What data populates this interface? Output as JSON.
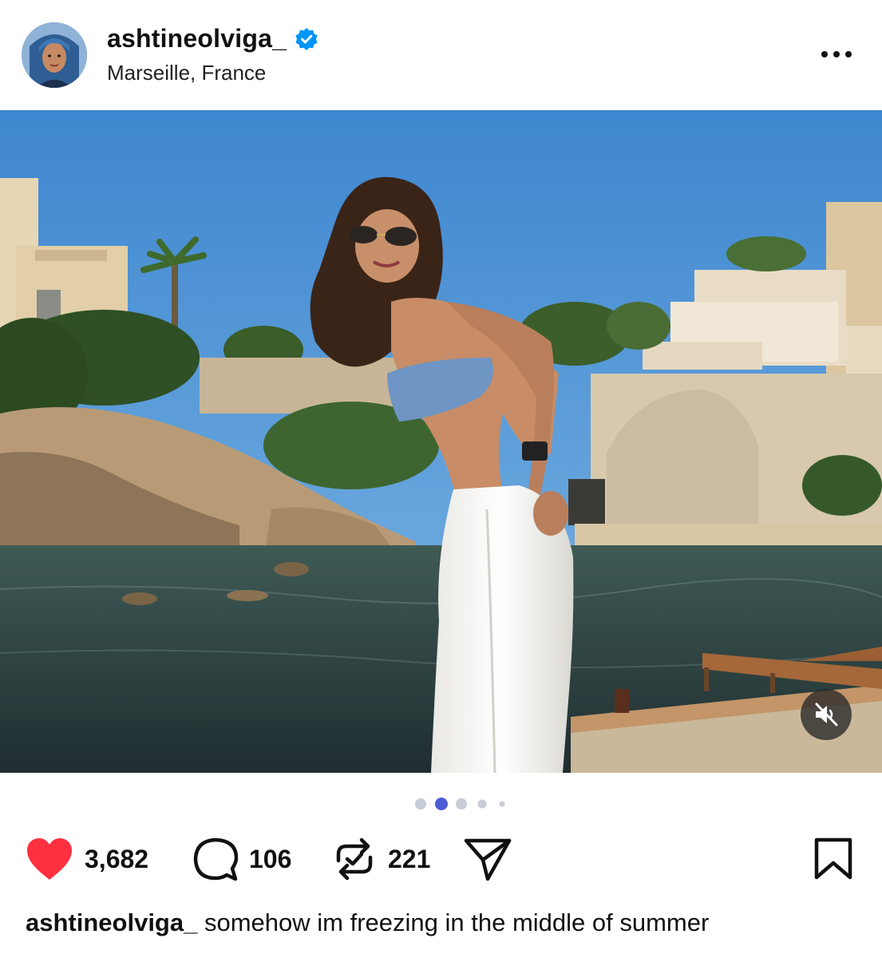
{
  "post": {
    "username": "ashtineolviga_",
    "location": "Marseille, France",
    "verified": true
  },
  "media": {
    "carousel_total": 5,
    "carousel_active": 2,
    "muted": true
  },
  "actions": {
    "likes": "3,682",
    "comments": "106",
    "reposts": "221"
  },
  "caption": {
    "username": "ashtineolviga_",
    "text": "somehow im freezing in the middle of summer"
  },
  "colors": {
    "like_red": "#ff3040",
    "verified_blue": "#0095f6",
    "dot_active": "#4f5bd5",
    "dot_inactive": "#c7ccd6"
  },
  "icons": {
    "verified": "verified-badge-icon",
    "more": "more-options-icon",
    "like": "heart-icon",
    "comment": "comment-icon",
    "repost": "repost-icon",
    "share": "send-icon",
    "save": "bookmark-icon",
    "mute": "speaker-muted-icon"
  }
}
